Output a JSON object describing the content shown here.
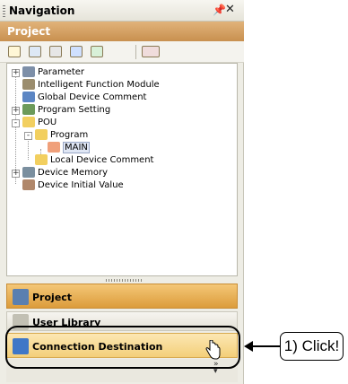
{
  "window": {
    "title": "Navigation",
    "pin_icon": "pin-icon",
    "close_icon": "close-icon"
  },
  "panel_header": "Project",
  "toolbar": {
    "icons": [
      "new-icon",
      "copy-icon",
      "paste-icon",
      "properties-icon",
      "refresh-icon",
      "tool-dropdown-icon"
    ]
  },
  "tree": [
    {
      "label": "Parameter",
      "icon": "parameter-icon",
      "expander": "+"
    },
    {
      "label": "Intelligent Function Module",
      "icon": "module-icon"
    },
    {
      "label": "Global Device Comment",
      "icon": "comment-icon"
    },
    {
      "label": "Program Setting",
      "icon": "program-setting-icon",
      "expander": "+"
    },
    {
      "label": "POU",
      "icon": "folder-icon",
      "expander": "-"
    },
    {
      "label": "Program",
      "icon": "folder-icon",
      "expander": "-"
    },
    {
      "label": "MAIN",
      "icon": "program-file-icon",
      "selected": true
    },
    {
      "label": "Local Device Comment",
      "icon": "folder-icon"
    },
    {
      "label": "Device Memory",
      "icon": "memory-icon",
      "expander": "+"
    },
    {
      "label": "Device Initial Value",
      "icon": "initial-value-icon"
    }
  ],
  "nav_buttons": {
    "project": "Project",
    "user_library": "User Library",
    "connection_destination": "Connection Destination"
  },
  "callout": {
    "text": "1) Click!"
  },
  "colors": {
    "accent_orange": "#dc9c3b",
    "header_orange": "#c8904f",
    "selected_bg": "#dfe6f4"
  }
}
